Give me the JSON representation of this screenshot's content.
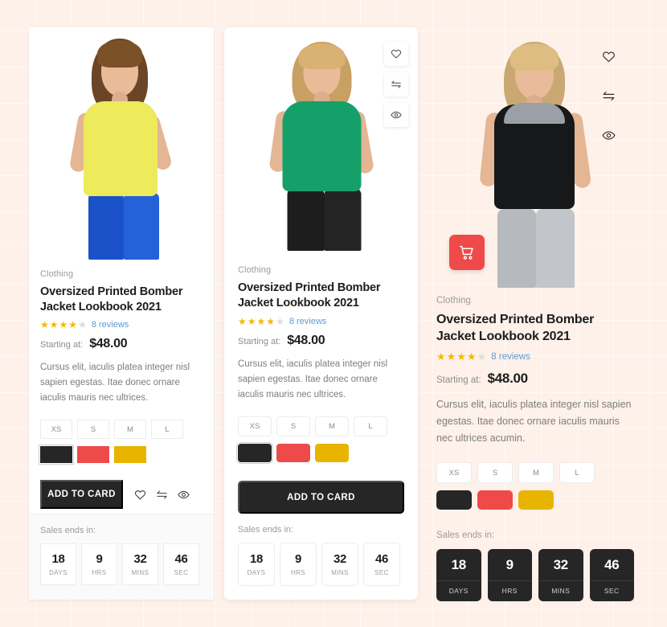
{
  "page": {
    "background_color": "#fdf1e9",
    "grid_line_color": "#ffffff"
  },
  "theme": {
    "accent_red": "#ef4a4a",
    "dark": "#262626",
    "star_gold": "#f6b800",
    "link_blue": "#5b9bd5",
    "swatch_black": "#262626",
    "swatch_red": "#ef4a4a",
    "swatch_yellow": "#e8b400"
  },
  "cards": [
    {
      "id": "product-card-1",
      "variant": "square",
      "eyebrow": "Clothing",
      "title": "Oversized Printed Bomber Jacket Lookbook 2021",
      "rating": {
        "filled": 4,
        "total": 5,
        "reviews_text": "8 reviews"
      },
      "price_label": "Starting at:",
      "price": "$48.00",
      "description": "Cursus elit, iaculis platea integer nisl sapien egestas. Itae donec ornare iaculis mauris nec ultrices.",
      "sizes": [
        "XS",
        "S",
        "M",
        "L"
      ],
      "colors": [
        {
          "name": "black",
          "hex": "#262626",
          "selected": true
        },
        {
          "name": "red",
          "hex": "#ef4a4a",
          "selected": false
        },
        {
          "name": "yellow",
          "hex": "#e8b400",
          "selected": false
        }
      ],
      "add_to_cart_label": "ADD TO CARD",
      "inline_icons": [
        "heart-icon",
        "compare-icon",
        "eye-icon"
      ],
      "countdown_label": "Sales ends in:",
      "countdown": [
        {
          "value": "18",
          "unit": "DAYS"
        },
        {
          "value": "9",
          "unit": "HRS"
        },
        {
          "value": "32",
          "unit": "MINS"
        },
        {
          "value": "46",
          "unit": "SEC"
        }
      ]
    },
    {
      "id": "product-card-2",
      "variant": "rounded",
      "eyebrow": "Clothing",
      "title": "Oversized Printed Bomber Jacket Lookbook 2021",
      "rating": {
        "filled": 4,
        "total": 5,
        "reviews_text": "8 reviews"
      },
      "price_label": "Starting at:",
      "price": "$48.00",
      "description": "Cursus elit, iaculis platea integer nisl sapien egestas. Itae donec ornare iaculis mauris nec ultrices.",
      "sizes": [
        "XS",
        "S",
        "M",
        "L"
      ],
      "colors": [
        {
          "name": "black",
          "hex": "#262626",
          "selected": true
        },
        {
          "name": "red",
          "hex": "#ef4a4a",
          "selected": false
        },
        {
          "name": "yellow",
          "hex": "#e8b400",
          "selected": false
        }
      ],
      "add_to_cart_label": "ADD TO CARD",
      "overlay_icons": [
        "heart-icon",
        "compare-icon",
        "eye-icon"
      ],
      "countdown_label": "Sales ends in:",
      "countdown": [
        {
          "value": "18",
          "unit": "DAYS"
        },
        {
          "value": "9",
          "unit": "HRS"
        },
        {
          "value": "32",
          "unit": "MINS"
        },
        {
          "value": "46",
          "unit": "SEC"
        }
      ]
    },
    {
      "id": "product-card-3",
      "variant": "transparent",
      "eyebrow": "Clothing",
      "title": "Oversized Printed Bomber Jacket Lookbook 2021",
      "rating": {
        "filled": 4,
        "total": 5,
        "reviews_text": "8 reviews"
      },
      "price_label": "Starting at:",
      "price": "$48.00",
      "description": "Cursus elit, iaculis platea integer nisl sapien egestas. Itae donec ornare iaculis mauris nec ultrices acumin.",
      "sizes": [
        "XS",
        "S",
        "M",
        "L"
      ],
      "colors": [
        {
          "name": "black",
          "hex": "#262626",
          "selected": false
        },
        {
          "name": "red",
          "hex": "#ef4a4a",
          "selected": false
        },
        {
          "name": "yellow",
          "hex": "#e8b400",
          "selected": false
        }
      ],
      "cart_button_icon": "shopping-cart-icon",
      "overlay_icons": [
        "heart-icon",
        "compare-icon",
        "eye-icon"
      ],
      "countdown_label": "Sales ends in:",
      "countdown": [
        {
          "value": "18",
          "unit": "DAYS"
        },
        {
          "value": "9",
          "unit": "HRS"
        },
        {
          "value": "32",
          "unit": "MINS"
        },
        {
          "value": "46",
          "unit": "SEC"
        }
      ]
    }
  ]
}
